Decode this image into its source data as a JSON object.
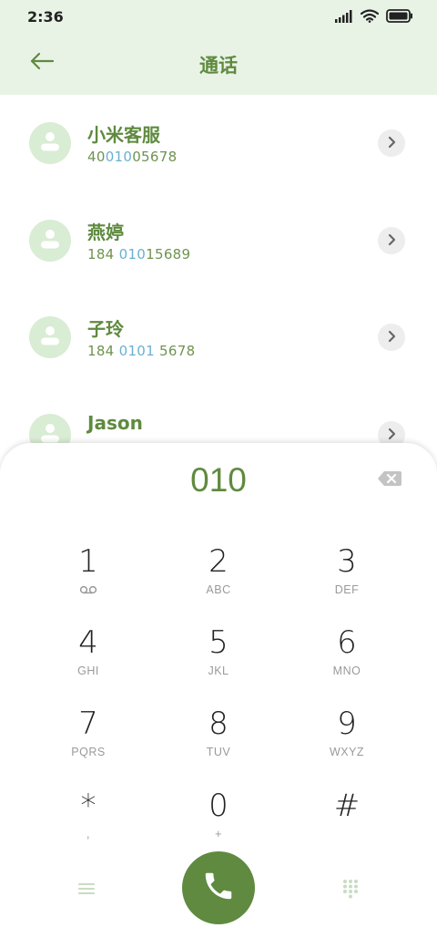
{
  "status": {
    "time": "2:36"
  },
  "header": {
    "title": "通话"
  },
  "contacts": [
    {
      "name": "小米客服",
      "num_pre": "40",
      "num_match": "010",
      "num_post": "05678"
    },
    {
      "name": "燕婷",
      "num_pre": "184 ",
      "num_match": "010",
      "num_post": "15689"
    },
    {
      "name": "子玲",
      "num_pre": "184 ",
      "num_match": "0101",
      "num_post": " 5678"
    },
    {
      "name": "Jason",
      "num_pre": "",
      "num_match": "",
      "num_post": ""
    }
  ],
  "dialer": {
    "display": "010",
    "keys": [
      {
        "digit": "1",
        "letters": ""
      },
      {
        "digit": "2",
        "letters": "ABC"
      },
      {
        "digit": "3",
        "letters": "DEF"
      },
      {
        "digit": "4",
        "letters": "GHI"
      },
      {
        "digit": "5",
        "letters": "JKL"
      },
      {
        "digit": "6",
        "letters": "MNO"
      },
      {
        "digit": "7",
        "letters": "PQRS"
      },
      {
        "digit": "8",
        "letters": "TUV"
      },
      {
        "digit": "9",
        "letters": "WXYZ"
      },
      {
        "digit": "*",
        "letters": ","
      },
      {
        "digit": "0",
        "letters": "+"
      },
      {
        "digit": "#",
        "letters": ""
      }
    ]
  },
  "icons": {
    "back": "arrow-left-icon",
    "backspace": "backspace-icon",
    "call": "phone-icon",
    "menu": "menu-icon",
    "keypad": "dialpad-icon",
    "voicemail": "voicemail-icon"
  },
  "colors": {
    "accent": "#5f8a3f",
    "header_bg": "#e8f3e6",
    "match": "#6ab0d2"
  }
}
